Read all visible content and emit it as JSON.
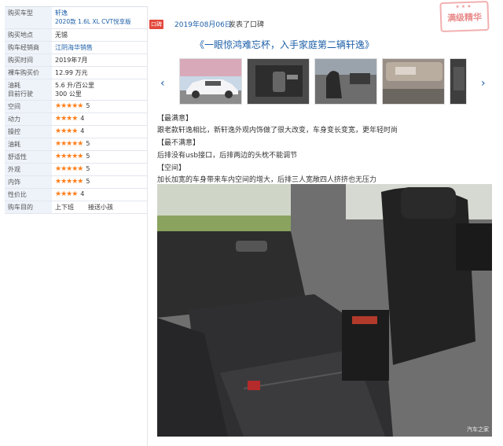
{
  "spec": [
    {
      "key": "购买车型",
      "value": "轩逸",
      "sub": "2020款 1.6L XL CVT悦享版",
      "link": true
    },
    {
      "key": "购买地点",
      "value": "无锡"
    },
    {
      "key": "购车经销商",
      "value": "江阴海华销售",
      "link": true
    },
    {
      "key": "购买时间",
      "value": "2019年7月"
    },
    {
      "key": "裸车购买价",
      "value": "12.99 万元"
    },
    {
      "key": "油耗",
      "key2": "目前行驶",
      "value": "5.6 升/百公里",
      "value2": "300 公里"
    }
  ],
  "ratings": [
    {
      "key": "空间",
      "stars": "★★★★★",
      "score": "5"
    },
    {
      "key": "动力",
      "stars": "★★★★",
      "score": "4"
    },
    {
      "key": "操控",
      "stars": "★★★★",
      "score": "4"
    },
    {
      "key": "油耗",
      "stars": "★★★★★",
      "score": "5"
    },
    {
      "key": "舒适性",
      "stars": "★★★★★",
      "score": "5"
    },
    {
      "key": "外观",
      "stars": "★★★★★",
      "score": "5"
    },
    {
      "key": "内饰",
      "stars": "★★★★★",
      "score": "5"
    },
    {
      "key": "性价比",
      "stars": "★★★★",
      "score": "4"
    }
  ],
  "purpose": {
    "key": "购车目的",
    "values": [
      "上下班",
      "接送小孩"
    ]
  },
  "review": {
    "badge": "口碑",
    "date": "2019年08月06日",
    "action": "发表了口碑",
    "stamp": "满级精华",
    "stamp_dots": "★★★",
    "title": "《一眼惊鸿难忘杯，入手家庭第二辆轩逸》",
    "sections": [
      {
        "heading": "【最满意】",
        "text": "跟老款轩逸相比，新轩逸外观内饰做了很大改变，车身变长变宽，更年轻时尚"
      },
      {
        "heading": "【最不满意】",
        "text": "后排没有usb接口，后排两边的头枕不能调节"
      },
      {
        "heading": "【空间】",
        "text": "加长加宽的车身带来车内空间的增大，后排三人宽敞四人挤挤也无压力"
      }
    ],
    "watermark": "汽车之家"
  },
  "colors": {
    "link": "#1d5fa8",
    "star": "#ff7e1a",
    "badge": "#e3483d"
  }
}
